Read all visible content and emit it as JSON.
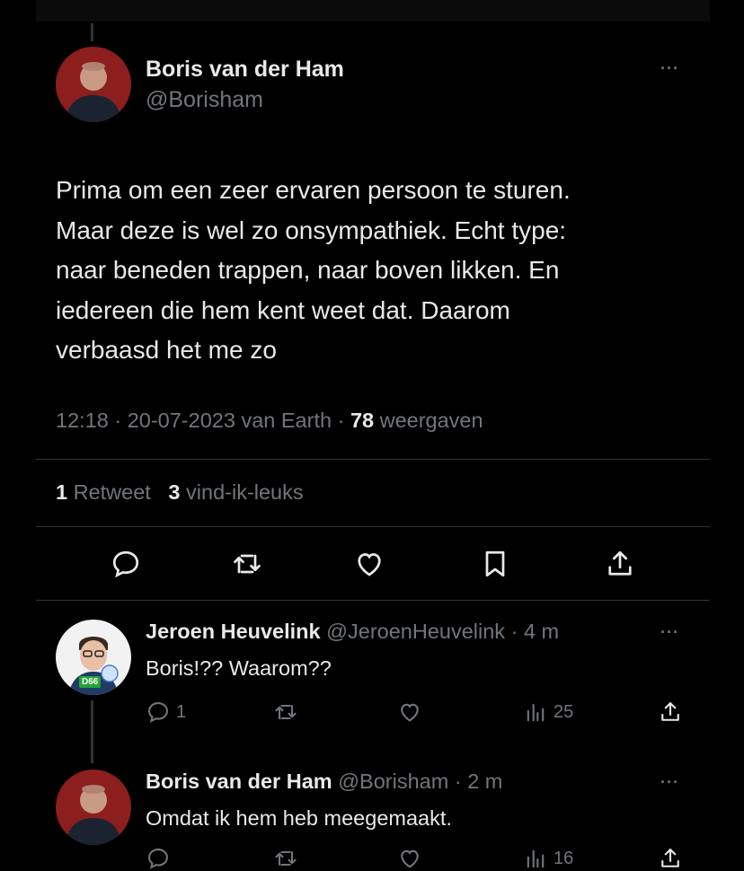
{
  "main_tweet": {
    "author_name": "Boris van der Ham",
    "author_handle": "@Borisham",
    "more_icon": "ellipsis-icon",
    "text_lines": [
      "Prima om een zeer ervaren persoon te sturen.",
      "Maar deze is wel zo onsympathiek. Echt type:",
      "naar beneden trappen, naar boven likken. En",
      "iedereen die hem kent weet dat. Daarom",
      "verbaasd het me zo"
    ],
    "time": "12:18",
    "date": "20-07-2023",
    "source": "van Earth",
    "views_count": "78",
    "views_label": "weergaven",
    "retweets_count": "1",
    "retweets_label": "Retweet",
    "likes_count": "3",
    "likes_label": "vind-ik-leuks"
  },
  "replies": [
    {
      "author_name": "Jeroen Heuvelink",
      "author_handle": "@JeroenHeuvelink",
      "time_ago": "4 m",
      "text": "Boris!?? Waarom??",
      "reply_count": "1",
      "views_count": "25",
      "badge": "D66"
    },
    {
      "author_name": "Boris van der Ham",
      "author_handle": "@Borisham",
      "time_ago": "2 m",
      "text": "Omdat ik hem heb meegemaakt.",
      "views_count": "16"
    }
  ],
  "colors": {
    "background": "#000000",
    "primary_text": "#e7e9ea",
    "secondary_text": "#71767b",
    "divider": "#2f3336"
  }
}
